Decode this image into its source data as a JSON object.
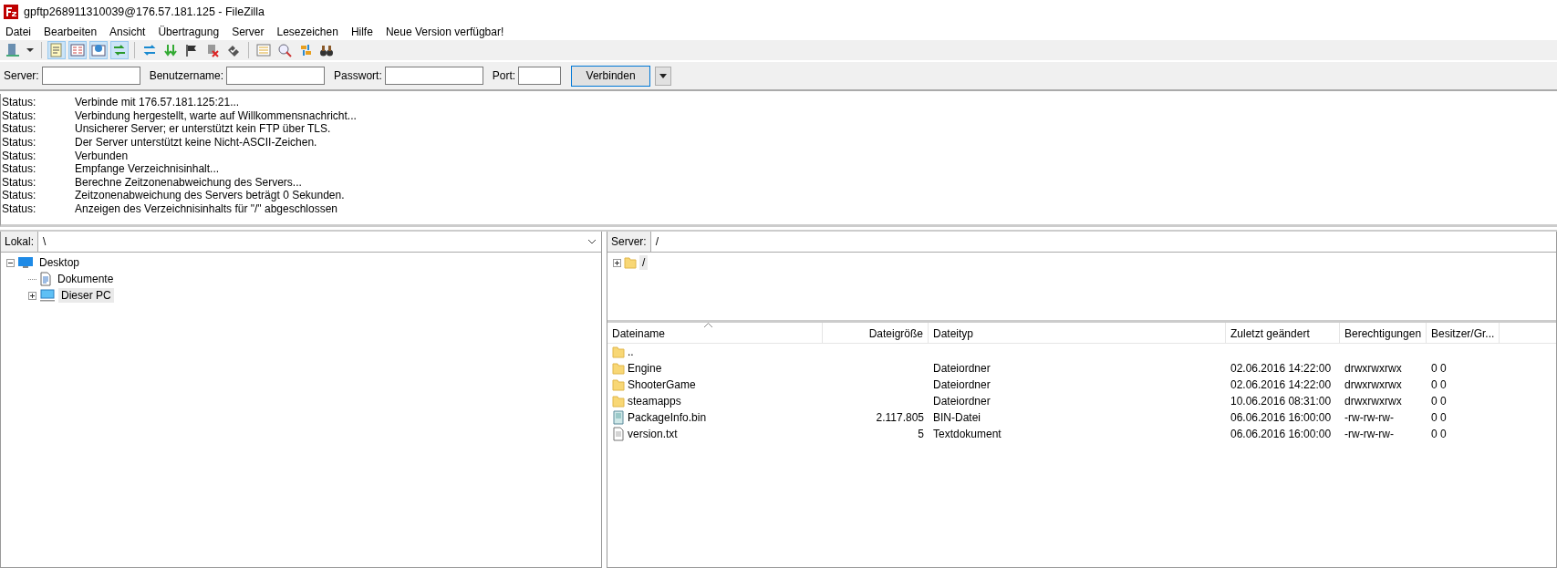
{
  "window": {
    "title": "gpftp268911310039@176.57.181.125 - FileZilla"
  },
  "menu": [
    "Datei",
    "Bearbeiten",
    "Ansicht",
    "Übertragung",
    "Server",
    "Lesezeichen",
    "Hilfe",
    "Neue Version verfügbar!"
  ],
  "toolbar": {
    "toggles": [
      {
        "on": true
      },
      {
        "on": true
      },
      {
        "on": true
      },
      {
        "on": true
      }
    ]
  },
  "quickconnect": {
    "fields": [
      {
        "label": "Server:"
      },
      {
        "label": "Benutzername:"
      },
      {
        "label": "Passwort:"
      },
      {
        "label": "Port:"
      }
    ],
    "button": "Verbinden"
  },
  "log": [
    {
      "kind": "Status:",
      "text": "Verbinde mit 176.57.181.125:21..."
    },
    {
      "kind": "Status:",
      "text": "Verbindung hergestellt, warte auf Willkommensnachricht..."
    },
    {
      "kind": "Status:",
      "text": "Unsicherer Server; er unterstützt kein FTP über TLS."
    },
    {
      "kind": "Status:",
      "text": "Der Server unterstützt keine Nicht-ASCII-Zeichen."
    },
    {
      "kind": "Status:",
      "text": "Verbunden"
    },
    {
      "kind": "Status:",
      "text": "Empfange Verzeichnisinhalt..."
    },
    {
      "kind": "Status:",
      "text": "Berechne Zeitzonenabweichung des Servers..."
    },
    {
      "kind": "Status:",
      "text": "Zeitzonenabweichung des Servers beträgt 0 Sekunden."
    },
    {
      "kind": "Status:",
      "text": "Anzeigen des Verzeichnisinhalts für \"/\" abgeschlossen"
    }
  ],
  "local": {
    "label": "Lokal:",
    "path": "\\",
    "tree": [
      {
        "name": "Desktop",
        "kind": "desktop",
        "expanded": true,
        "selected": false,
        "children": [
          {
            "name": "Dokumente",
            "kind": "document",
            "selected": false
          },
          {
            "name": "Dieser PC",
            "kind": "computer",
            "expanded": false,
            "selected": true
          }
        ]
      }
    ]
  },
  "remote": {
    "label": "Server:",
    "path": "/",
    "tree": [
      {
        "name": "/",
        "kind": "folder",
        "expanded": false,
        "selected": true
      }
    ],
    "columns": [
      {
        "label": "Dateiname",
        "sorted": true
      },
      {
        "label": "Dateigröße",
        "sorted": false
      },
      {
        "label": "Dateityp",
        "sorted": false
      },
      {
        "label": "Zuletzt geändert",
        "sorted": false
      },
      {
        "label": "Berechtigungen",
        "sorted": false
      },
      {
        "label": "Besitzer/Gr...",
        "sorted": false
      }
    ],
    "rows": [
      {
        "kind": "folder",
        "cells": [
          "..",
          "",
          "",
          "",
          "",
          ""
        ]
      },
      {
        "kind": "folder",
        "cells": [
          "Engine",
          "",
          "Dateiordner",
          "02.06.2016 14:22:00",
          "drwxrwxrwx",
          "0 0"
        ]
      },
      {
        "kind": "folder",
        "cells": [
          "ShooterGame",
          "",
          "Dateiordner",
          "02.06.2016 14:22:00",
          "drwxrwxrwx",
          "0 0"
        ]
      },
      {
        "kind": "folder",
        "cells": [
          "steamapps",
          "",
          "Dateiordner",
          "10.06.2016 08:31:00",
          "drwxrwxrwx",
          "0 0"
        ]
      },
      {
        "kind": "binary",
        "cells": [
          "PackageInfo.bin",
          "2.117.805",
          "BIN-Datei",
          "06.06.2016 16:00:00",
          "-rw-rw-rw-",
          "0 0"
        ]
      },
      {
        "kind": "text",
        "cells": [
          "version.txt",
          "5",
          "Textdokument",
          "06.06.2016 16:00:00",
          "-rw-rw-rw-",
          "0 0"
        ]
      }
    ]
  }
}
